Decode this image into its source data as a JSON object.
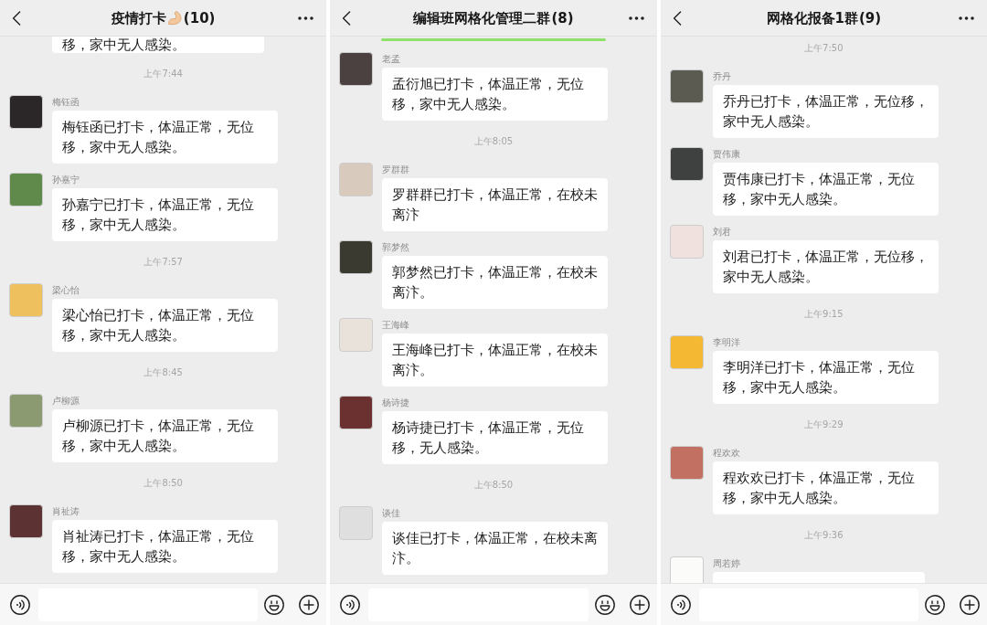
{
  "panels": [
    {
      "title": "疫情打卡",
      "title_icon": true,
      "member_count": "(10)",
      "loading_bar": false,
      "items": [
        {
          "kind": "cut_top",
          "text": "移，家中无人感染。"
        },
        {
          "kind": "time",
          "text": "上午7:44"
        },
        {
          "kind": "message",
          "name": "梅钰函",
          "color": "#2b2628",
          "text": "梅钰函已打卡，体温正常，无位移，家中无人感染。"
        },
        {
          "kind": "message",
          "name": "孙嘉宁",
          "color": "#5f8a4c",
          "text": "孙嘉宁已打卡，体温正常，无位移，家中无人感染。"
        },
        {
          "kind": "time",
          "text": "上午7:57"
        },
        {
          "kind": "message",
          "name": "梁心怡",
          "color": "#efc15e",
          "text": "梁心怡已打卡，体温正常，无位移，家中无人感染。"
        },
        {
          "kind": "time",
          "text": "上午8:45"
        },
        {
          "kind": "message",
          "name": "卢柳源",
          "color": "#8c9a72",
          "text": "卢柳源已打卡，体温正常，无位移，家中无人感染。"
        },
        {
          "kind": "time",
          "text": "上午8:50"
        },
        {
          "kind": "message",
          "name": "肖祉涛",
          "color": "#5c3232",
          "text": "肖祉涛已打卡，体温正常，无位移，家中无人感染。"
        }
      ]
    },
    {
      "title": "编辑班网格化管理二群",
      "title_icon": false,
      "member_count": "(8)",
      "loading_bar": true,
      "items": [
        {
          "kind": "message",
          "name": "老孟",
          "color": "#4b4141",
          "text": "孟衍旭已打卡，体温正常，无位移，家中无人感染。"
        },
        {
          "kind": "time",
          "text": "上午8:05"
        },
        {
          "kind": "message",
          "name": "罗群群",
          "color": "#d8cbbd",
          "text": "罗群群已打卡，体温正常，在校未离汴"
        },
        {
          "kind": "message",
          "name": "郭梦然",
          "color": "#3b3a31",
          "text": "郭梦然已打卡，体温正常，在校未离汴。"
        },
        {
          "kind": "message",
          "name": "王海峰",
          "color": "#e9e2da",
          "text": "王海峰已打卡，体温正常，在校未离汴。"
        },
        {
          "kind": "message",
          "name": "杨诗捷",
          "color": "#6b3131",
          "text": "杨诗捷已打卡，体温正常，无位移，无人感染。"
        },
        {
          "kind": "time",
          "text": "上午8:50"
        },
        {
          "kind": "message",
          "name": "谈佳",
          "color": "#dfdfdf",
          "text": "谈佳已打卡，体温正常，在校未离汴。"
        }
      ]
    },
    {
      "title": "网格化报备1群",
      "title_icon": false,
      "member_count": "(9)",
      "loading_bar": false,
      "items": [
        {
          "kind": "time",
          "text": "上午7:50"
        },
        {
          "kind": "message",
          "name": "乔丹",
          "color": "#5b5b52",
          "text": "乔丹已打卡，体温正常，无位移，家中无人感染。"
        },
        {
          "kind": "message",
          "name": "贾伟康",
          "color": "#3f4040",
          "text": "贾伟康已打卡，体温正常，无位移，家中无人感染。"
        },
        {
          "kind": "message",
          "name": "刘君",
          "color": "#f0e1df",
          "text": "刘君已打卡，体温正常，无位移，家中无人感染。"
        },
        {
          "kind": "time",
          "text": "上午9:15"
        },
        {
          "kind": "message",
          "name": "李明洋",
          "color": "#f4b832",
          "text": "李明洋已打卡，体温正常，无位移，家中无人感染。"
        },
        {
          "kind": "time",
          "text": "上午9:29"
        },
        {
          "kind": "message",
          "name": "程欢欢",
          "color": "#c27062",
          "text": "程欢欢已打卡，体温正常，无位移，家中无人感染。"
        },
        {
          "kind": "time",
          "text": "上午9:36"
        },
        {
          "kind": "cut_bottom",
          "name": "周若婷",
          "color": "#fbfbf9"
        }
      ]
    }
  ]
}
